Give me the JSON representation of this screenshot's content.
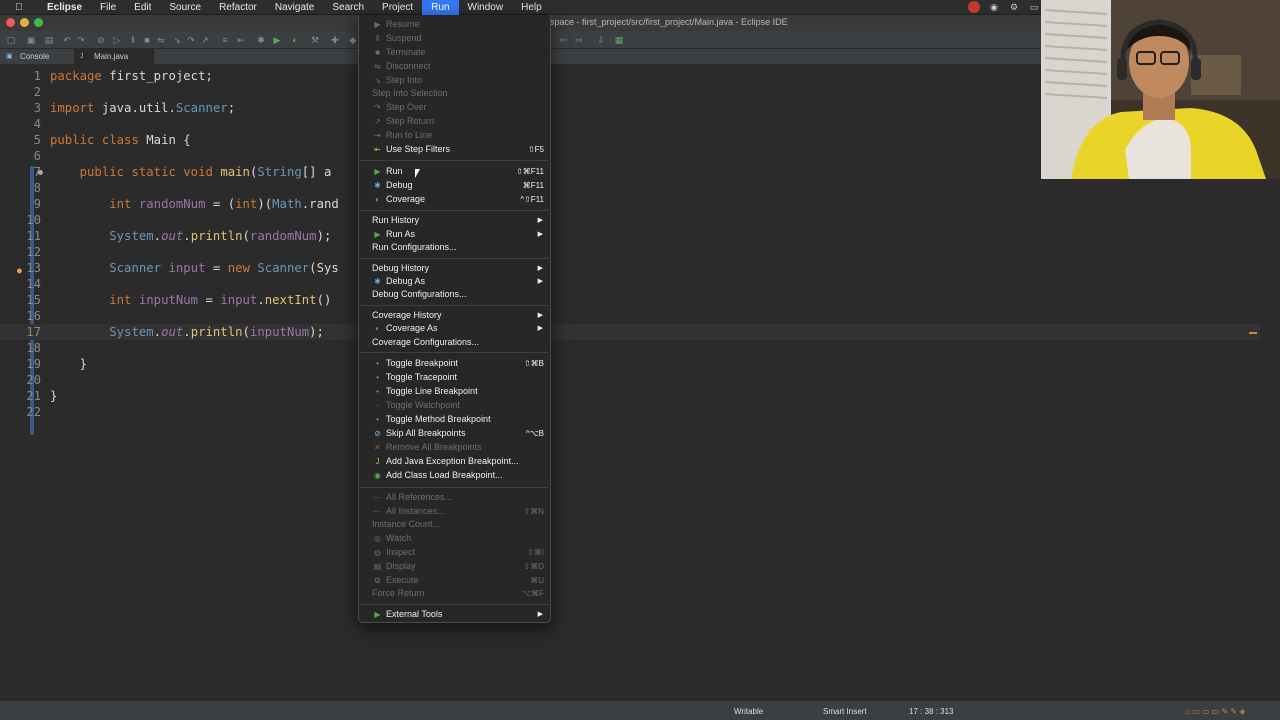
{
  "menubar": {
    "apple_icon": "apple-icon",
    "app": "Eclipse",
    "items": [
      "File",
      "Edit",
      "Source",
      "Refactor",
      "Navigate",
      "Search",
      "Project",
      "Run",
      "Window",
      "Help"
    ],
    "active": "Run"
  },
  "window": {
    "title": "space - first_project/src/first_project/Main.java - Eclipse IDE"
  },
  "tabs": [
    {
      "label": "Console",
      "icon": "console-icon"
    },
    {
      "label": "Main.java",
      "icon": "java-file-icon"
    }
  ],
  "editor": {
    "lines": [
      {
        "n": "1",
        "text": "package first_project;"
      },
      {
        "n": "2",
        "text": ""
      },
      {
        "n": "3",
        "text": "import java.util.Scanner;"
      },
      {
        "n": "4",
        "text": ""
      },
      {
        "n": "5",
        "text": "public class Main {"
      },
      {
        "n": "6",
        "text": ""
      },
      {
        "n": "7",
        "text": "    public static void main(String[] a"
      },
      {
        "n": "8",
        "text": ""
      },
      {
        "n": "9",
        "text": "        int randomNum = (int)(Math.rand"
      },
      {
        "n": "10",
        "text": ""
      },
      {
        "n": "11",
        "text": "        System.out.println(randomNum);"
      },
      {
        "n": "12",
        "text": ""
      },
      {
        "n": "13",
        "text": "        Scanner input = new Scanner(Sys"
      },
      {
        "n": "14",
        "text": ""
      },
      {
        "n": "15",
        "text": "        int inputNum = input.nextInt()"
      },
      {
        "n": "16",
        "text": ""
      },
      {
        "n": "17",
        "text": "        System.out.println(inputNum);"
      },
      {
        "n": "18",
        "text": ""
      },
      {
        "n": "19",
        "text": "    }"
      },
      {
        "n": "20",
        "text": ""
      },
      {
        "n": "21",
        "text": "}"
      },
      {
        "n": "22",
        "text": ""
      }
    ]
  },
  "run_menu": {
    "items": [
      {
        "label": "Resume",
        "enabled": false,
        "icon": "resume-icon"
      },
      {
        "label": "Suspend",
        "enabled": false,
        "icon": "suspend-icon"
      },
      {
        "label": "Terminate",
        "enabled": false,
        "icon": "terminate-icon"
      },
      {
        "label": "Disconnect",
        "enabled": false,
        "icon": "disconnect-icon"
      },
      {
        "label": "Step Into",
        "enabled": false,
        "icon": "step-into-icon"
      },
      {
        "label": "Step Into Selection",
        "enabled": false
      },
      {
        "label": "Step Over",
        "enabled": false,
        "icon": "step-over-icon"
      },
      {
        "label": "Step Return",
        "enabled": false,
        "icon": "step-return-icon"
      },
      {
        "label": "Run to Line",
        "enabled": false,
        "icon": "run-to-line-icon"
      },
      {
        "label": "Use Step Filters",
        "enabled": true,
        "icon": "step-filters-icon",
        "shortcut": "⇧F5"
      },
      {
        "label": "Run",
        "enabled": true,
        "icon": "run-icon",
        "shortcut": "⇧⌘F11"
      },
      {
        "label": "Debug",
        "enabled": true,
        "icon": "debug-icon",
        "shortcut": "⌘F11"
      },
      {
        "label": "Coverage",
        "enabled": true,
        "icon": "coverage-icon",
        "shortcut": "^⇧F11"
      },
      {
        "label": "Run History",
        "enabled": true,
        "submenu": true
      },
      {
        "label": "Run As",
        "enabled": true,
        "icon": "run-icon",
        "submenu": true
      },
      {
        "label": "Run Configurations...",
        "enabled": true
      },
      {
        "label": "Debug History",
        "enabled": true,
        "submenu": true
      },
      {
        "label": "Debug As",
        "enabled": true,
        "icon": "debug-icon",
        "submenu": true
      },
      {
        "label": "Debug Configurations...",
        "enabled": true
      },
      {
        "label": "Coverage History",
        "enabled": true,
        "submenu": true
      },
      {
        "label": "Coverage As",
        "enabled": true,
        "icon": "coverage-icon",
        "submenu": true
      },
      {
        "label": "Coverage Configurations...",
        "enabled": true
      },
      {
        "label": "Toggle Breakpoint",
        "enabled": true,
        "icon": "breakpoint-icon",
        "shortcut": "⇧⌘B"
      },
      {
        "label": "Toggle Tracepoint",
        "enabled": true,
        "icon": "breakpoint-icon"
      },
      {
        "label": "Toggle Line Breakpoint",
        "enabled": true,
        "icon": "breakpoint-icon"
      },
      {
        "label": "Toggle Watchpoint",
        "enabled": false,
        "icon": "watchpoint-icon"
      },
      {
        "label": "Toggle Method Breakpoint",
        "enabled": true,
        "icon": "breakpoint-icon"
      },
      {
        "label": "Skip All Breakpoints",
        "enabled": true,
        "icon": "skip-breakpoints-icon",
        "shortcut": "^⌥B"
      },
      {
        "label": "Remove All Breakpoints",
        "enabled": false,
        "icon": "remove-breakpoints-icon"
      },
      {
        "label": "Add Java Exception Breakpoint...",
        "enabled": true,
        "icon": "exception-breakpoint-icon"
      },
      {
        "label": "Add Class Load Breakpoint...",
        "enabled": true,
        "icon": "class-load-breakpoint-icon"
      },
      {
        "label": "All References...",
        "enabled": false,
        "icon": "references-icon"
      },
      {
        "label": "All Instances...",
        "enabled": false,
        "icon": "instances-icon",
        "shortcut": "⇧⌘N"
      },
      {
        "label": "Instance Count...",
        "enabled": false
      },
      {
        "label": "Watch",
        "enabled": false,
        "icon": "watch-icon"
      },
      {
        "label": "Inspect",
        "enabled": false,
        "icon": "inspect-icon",
        "shortcut": "⇧⌘I"
      },
      {
        "label": "Display",
        "enabled": false,
        "icon": "display-icon",
        "shortcut": "⇧⌘D"
      },
      {
        "label": "Execute",
        "enabled": false,
        "icon": "execute-icon",
        "shortcut": "⌘U"
      },
      {
        "label": "Force Return",
        "enabled": false,
        "shortcut": "⌥⌘F"
      },
      {
        "label": "External Tools",
        "enabled": true,
        "icon": "external-tools-icon",
        "submenu": true
      }
    ]
  },
  "statusbar": {
    "writable": "Writable",
    "insert_mode": "Smart Insert",
    "position": "17 : 38 : 313"
  },
  "colors": {
    "menu_highlight": "#3478f6",
    "editor_bg": "#2b2b2b",
    "keyword": "#cc7832"
  }
}
